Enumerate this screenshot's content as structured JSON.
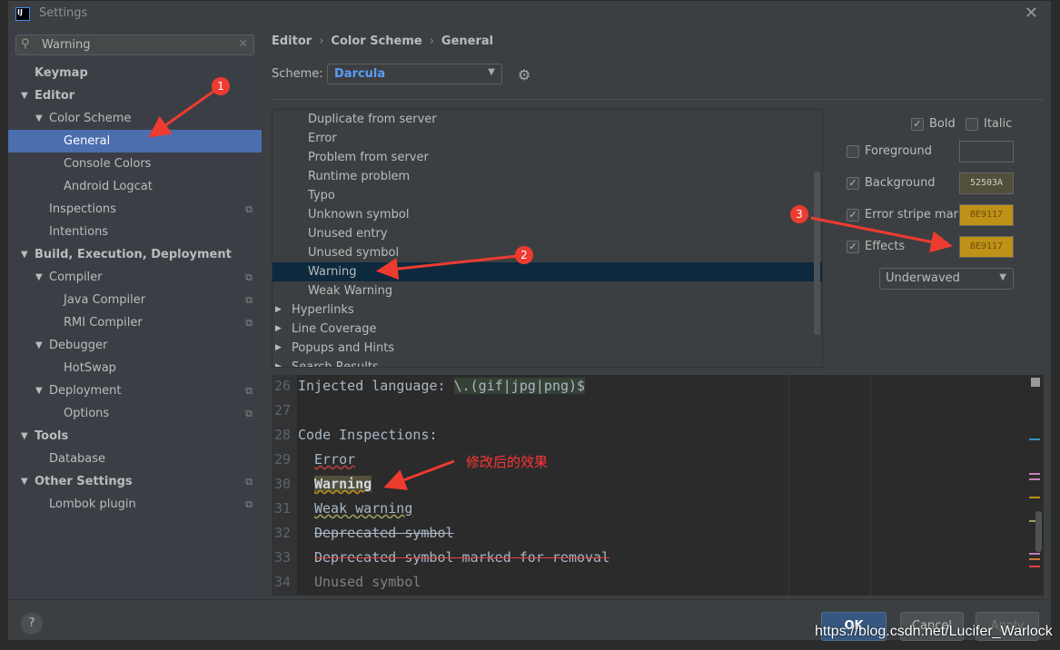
{
  "window": {
    "title": "Settings",
    "logo": "IJ",
    "close_icon": "close-icon"
  },
  "search": {
    "value": "Warning"
  },
  "tree": [
    {
      "label": "Keymap",
      "level": 0,
      "bold": true
    },
    {
      "label": "Editor",
      "level": 0,
      "bold": true,
      "expanded": true
    },
    {
      "label": "Color Scheme",
      "level": 1,
      "expanded": true
    },
    {
      "label": "General",
      "level": 2,
      "selected": true
    },
    {
      "label": "Console Colors",
      "level": 2
    },
    {
      "label": "Android Logcat",
      "level": 2
    },
    {
      "label": "Inspections",
      "level": 1,
      "copy": true
    },
    {
      "label": "Intentions",
      "level": 1
    },
    {
      "label": "Build, Execution, Deployment",
      "level": 0,
      "bold": true,
      "expanded": true
    },
    {
      "label": "Compiler",
      "level": 1,
      "expanded": true,
      "copy": true
    },
    {
      "label": "Java Compiler",
      "level": 2,
      "copy": true
    },
    {
      "label": "RMI Compiler",
      "level": 2,
      "copy": true
    },
    {
      "label": "Debugger",
      "level": 1,
      "expanded": true
    },
    {
      "label": "HotSwap",
      "level": 2
    },
    {
      "label": "Deployment",
      "level": 1,
      "expanded": true,
      "copy": true
    },
    {
      "label": "Options",
      "level": 2,
      "copy": true
    },
    {
      "label": "Tools",
      "level": 0,
      "bold": true,
      "expanded": true
    },
    {
      "label": "Database",
      "level": 1
    },
    {
      "label": "Other Settings",
      "level": 0,
      "bold": true,
      "expanded": true,
      "copy": true
    },
    {
      "label": "Lombok plugin",
      "level": 1,
      "copy": true
    }
  ],
  "breadcrumb": [
    "Editor",
    "Color Scheme",
    "General"
  ],
  "scheme": {
    "label": "Scheme:",
    "value": "Darcula"
  },
  "attributes": [
    {
      "label": "Duplicate from server"
    },
    {
      "label": "Error"
    },
    {
      "label": "Problem from server"
    },
    {
      "label": "Runtime problem"
    },
    {
      "label": "Typo"
    },
    {
      "label": "Unknown symbol"
    },
    {
      "label": "Unused entry"
    },
    {
      "label": "Unused symbol"
    },
    {
      "label": "Warning",
      "selected": true
    },
    {
      "label": "Weak Warning"
    },
    {
      "label": "Hyperlinks",
      "group": true
    },
    {
      "label": "Line Coverage",
      "group": true
    },
    {
      "label": "Popups and Hints",
      "group": true
    },
    {
      "label": "Search Results",
      "group": true
    }
  ],
  "props": {
    "bold": {
      "label": "Bold",
      "checked": true
    },
    "italic": {
      "label": "Italic",
      "checked": false
    },
    "foreground": {
      "label": "Foreground",
      "checked": false,
      "value": ""
    },
    "background": {
      "label": "Background",
      "checked": true,
      "value": "52503A",
      "color": "#52503A"
    },
    "error_stripe": {
      "label": "Error stripe mark",
      "checked": true,
      "value": "BE9117",
      "color": "#BE9117"
    },
    "effects": {
      "label": "Effects",
      "checked": true,
      "value": "BE9117",
      "color": "#BE9117"
    },
    "effect_type": "Underwaved"
  },
  "preview": [
    {
      "n": "26",
      "text": "Injected language: ",
      "inj": "\\.(gif|jpg|png)$"
    },
    {
      "n": "27",
      "text": ""
    },
    {
      "n": "28",
      "text": "Code Inspections:"
    },
    {
      "n": "29",
      "text": "Error",
      "style": "error"
    },
    {
      "n": "30",
      "text": "Warning",
      "style": "warning"
    },
    {
      "n": "31",
      "text": "Weak warning",
      "style": "weak"
    },
    {
      "n": "32",
      "text": "Deprecated symbol",
      "style": "dep"
    },
    {
      "n": "33",
      "text": "Deprecated symbol marked for removal",
      "style": "depr"
    },
    {
      "n": "34",
      "text": "Unused symbol",
      "style": "unused"
    }
  ],
  "buttons": {
    "help": "?",
    "ok": "OK",
    "cancel": "Cancel",
    "apply": "Apply"
  },
  "annotations": {
    "n1": "1",
    "n2": "2",
    "n3": "3",
    "note": "修改后的效果",
    "color": "#ee3b30"
  },
  "watermark": "https://blog.csdn.net/Lucifer_Warlock"
}
